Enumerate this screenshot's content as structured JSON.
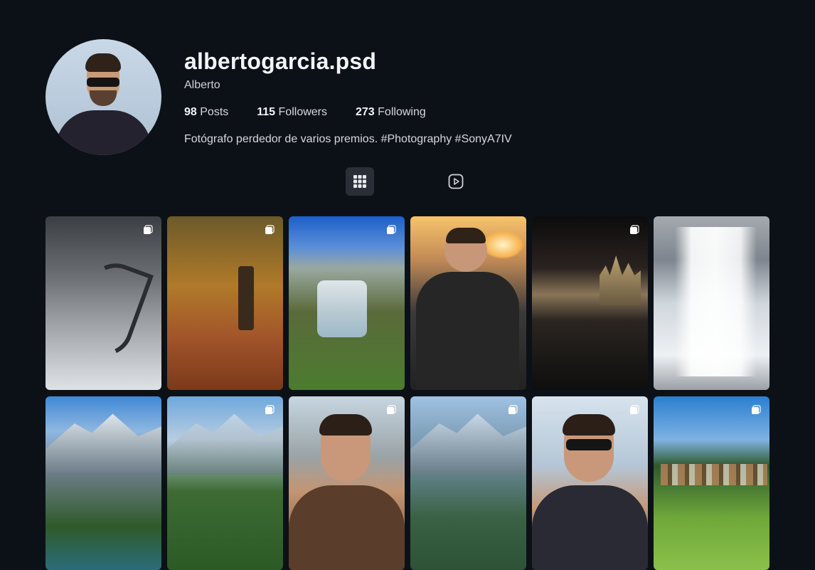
{
  "profile": {
    "username": "albertogarcia.psd",
    "name": "Alberto",
    "stats": {
      "posts_count": "98",
      "posts_label": "Posts",
      "followers_count": "115",
      "followers_label": "Followers",
      "following_count": "273",
      "following_label": "Following"
    },
    "bio": "Fotógrafo perdedor de varios premios. #Photography #SonyA7IV"
  },
  "tabs": [
    {
      "icon": "grid-icon",
      "active": true
    },
    {
      "icon": "reels-play-icon",
      "active": false
    }
  ],
  "posts": [
    {
      "scene": "snowy winding road",
      "multiple": true
    },
    {
      "scene": "autumn forest tree",
      "multiple": true
    },
    {
      "scene": "mountain waterfall with blue sky",
      "multiple": true
    },
    {
      "scene": "portrait at sunset",
      "multiple": false
    },
    {
      "scene": "cathedral at night with reflection",
      "multiple": true
    },
    {
      "scene": "large waterfall with person",
      "multiple": false
    },
    {
      "scene": "alpine lake and mountains",
      "multiple": false
    },
    {
      "scene": "forest valley with waterfall",
      "multiple": true
    },
    {
      "scene": "portrait smiling",
      "multiple": true
    },
    {
      "scene": "green mountain valley",
      "multiple": true
    },
    {
      "scene": "portrait with sunglasses",
      "multiple": true
    },
    {
      "scene": "green hills with village",
      "multiple": true
    }
  ],
  "colors": {
    "background": "#0c1117",
    "active_tab_bg": "#2a2f37",
    "text_primary": "#f3f4f6"
  }
}
